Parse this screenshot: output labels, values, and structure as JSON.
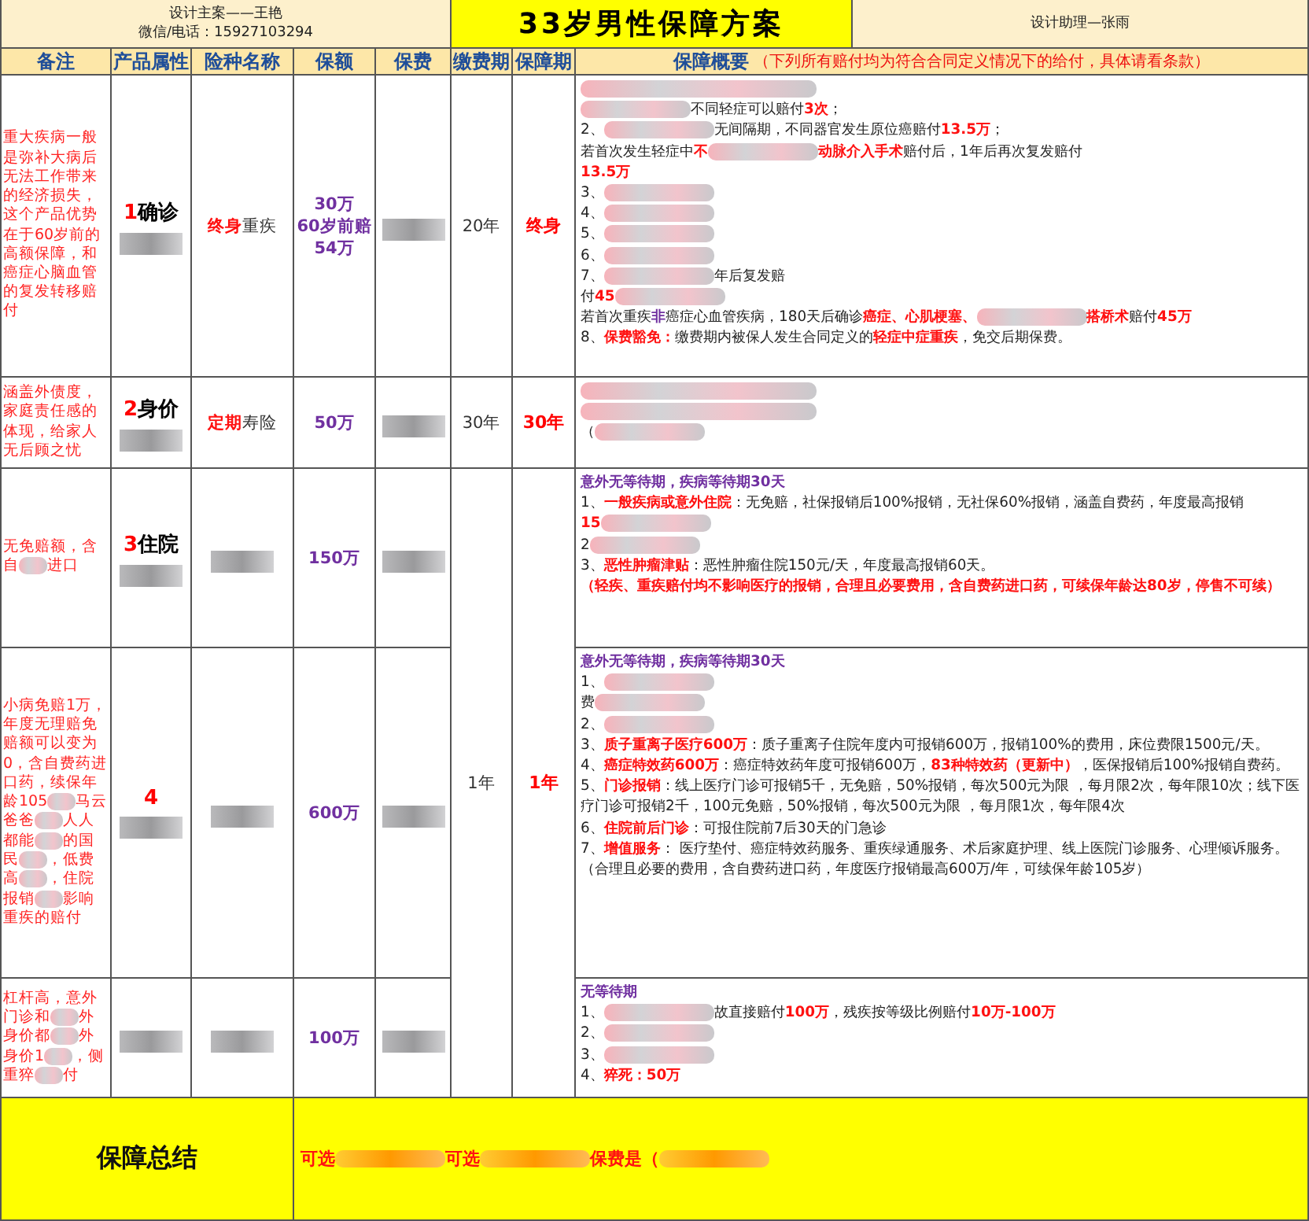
{
  "header": {
    "designer": [
      "设计主案——王艳",
      "微信/电话：15927103294"
    ],
    "title": "33岁男性保障方案",
    "assistant": "设计助理—张雨"
  },
  "columns": [
    {
      "label": "备注"
    },
    {
      "label": "产品属性"
    },
    {
      "label": "险种名称"
    },
    {
      "label": "保额"
    },
    {
      "label": "保费"
    },
    {
      "label": "缴费期"
    },
    {
      "label": "保障期"
    },
    {
      "label": "保障概要",
      "note": "（下列所有赔付均为符合合同定义情况下的给付，具体请看条款）"
    }
  ],
  "rows": [
    {
      "remark": [
        {
          "kind": "plain",
          "t": "重大疾病一般是弥补大病后无法工作带来的经济损失，这个产品优势在于60岁前的高额保障，和癌症心脑血管的复发转移赔付"
        }
      ],
      "product": {
        "number": "1",
        "name": "确诊"
      },
      "insurance": [
        {
          "kind": "red",
          "t": "终身"
        },
        {
          "kind": "plain",
          "t": "重疾"
        }
      ],
      "amount": [
        "30万",
        "60岁前赔",
        "54万"
      ],
      "pay_period": "20年",
      "term": "终身",
      "summary": [
        [
          {
            "kind": "redacted"
          }
        ],
        [
          {
            "kind": "redacted"
          },
          {
            "kind": "plain",
            "t": "不同轻症可以赔付"
          },
          {
            "kind": "red",
            "t": "3次"
          },
          {
            "kind": "plain",
            "t": "；"
          }
        ],
        [
          {
            "kind": "plain",
            "t": "2、"
          },
          {
            "kind": "redacted"
          },
          {
            "kind": "plain",
            "t": "无间隔期，不同器官发生原位癌赔付"
          },
          {
            "kind": "red",
            "t": "13.5万"
          },
          {
            "kind": "plain",
            "t": "；"
          }
        ],
        [
          {
            "kind": "plain",
            "t": "若首次发生轻症中"
          },
          {
            "kind": "red",
            "t": "不"
          },
          {
            "kind": "redacted"
          },
          {
            "kind": "red",
            "t": "动脉介入手术"
          },
          {
            "kind": "plain",
            "t": "赔付后，1年后再次复发赔付"
          }
        ],
        [
          {
            "kind": "red",
            "t": "13.5万"
          }
        ],
        [
          {
            "kind": "plain",
            "t": "3、"
          },
          {
            "kind": "redacted"
          }
        ],
        [
          {
            "kind": "plain",
            "t": "4、"
          },
          {
            "kind": "redacted"
          }
        ],
        [
          {
            "kind": "plain",
            "t": "5、"
          },
          {
            "kind": "redacted"
          }
        ],
        [
          {
            "kind": "plain",
            "t": "6、"
          },
          {
            "kind": "redacted"
          }
        ],
        [
          {
            "kind": "plain",
            "t": "7、"
          },
          {
            "kind": "redacted"
          },
          {
            "kind": "plain",
            "t": "年后复发赔"
          }
        ],
        [
          {
            "kind": "plain",
            "t": "付"
          },
          {
            "kind": "red",
            "t": "45"
          },
          {
            "kind": "redacted"
          }
        ],
        [
          {
            "kind": "plain",
            "t": "若首次重疾"
          },
          {
            "kind": "purple",
            "t": "非"
          },
          {
            "kind": "plain",
            "t": "癌症心血管疾病，180天后确诊"
          },
          {
            "kind": "red",
            "t": "癌症、心肌梗塞、"
          },
          {
            "kind": "redacted"
          },
          {
            "kind": "red",
            "t": "搭桥术"
          },
          {
            "kind": "plain",
            "t": "赔付"
          },
          {
            "kind": "red",
            "t": "45万"
          }
        ],
        [
          {
            "kind": "plain",
            "t": "8、"
          },
          {
            "kind": "red",
            "t": "保费豁免："
          },
          {
            "kind": "plain",
            "t": "缴费期内被保人发生合同定义的"
          },
          {
            "kind": "red",
            "t": "轻症中症重疾"
          },
          {
            "kind": "plain",
            "t": "，免交后期保费。"
          }
        ]
      ]
    },
    {
      "remark": [
        {
          "kind": "plain",
          "t": "涵盖外债度，家庭责任感的体现，给家人无后顾之忧"
        }
      ],
      "product": {
        "number": "2",
        "name": "身价"
      },
      "insurance": [
        {
          "kind": "red",
          "t": "定期"
        },
        {
          "kind": "plain",
          "t": "寿险"
        }
      ],
      "amount": [
        "50万"
      ],
      "pay_period": "30年",
      "term": "30年",
      "summary": [
        [
          {
            "kind": "redacted"
          }
        ],
        [
          {
            "kind": "redacted"
          }
        ],
        [
          {
            "kind": "plain",
            "t": "（"
          },
          {
            "kind": "redacted"
          }
        ]
      ]
    }
  ],
  "grouped_rows": {
    "pay_period": "1年",
    "term": "1年",
    "rows": [
      {
        "remark": [
          {
            "kind": "plain",
            "t": "无免赔额，含自"
          },
          {
            "kind": "redacted"
          },
          {
            "kind": "plain",
            "t": "进口"
          }
        ],
        "product": {
          "number": "3",
          "name": "住院"
        },
        "amount": [
          "150万"
        ],
        "summary": [
          [
            {
              "kind": "purple",
              "t": "意外无等待期，疾病等待期30天"
            }
          ],
          [
            {
              "kind": "plain",
              "t": "1、"
            },
            {
              "kind": "red",
              "t": "一般疾病或意外住院"
            },
            {
              "kind": "plain",
              "t": "：无免赔，社保报销后100%报销，无社保60%报销，涵盖自费药，年度最高报销"
            }
          ],
          [
            {
              "kind": "red",
              "t": "15"
            },
            {
              "kind": "redacted"
            }
          ],
          [
            {
              "kind": "plain",
              "t": "2"
            },
            {
              "kind": "redacted"
            }
          ],
          [
            {
              "kind": "plain",
              "t": "3、"
            },
            {
              "kind": "red",
              "t": "恶性肿瘤津贴"
            },
            {
              "kind": "plain",
              "t": "：恶性肿瘤住院150元/天，年度最高报销60天。"
            }
          ],
          [
            {
              "kind": "red",
              "t": "（轻疾、重疾赔付均不影响医疗的报销，合理且必要费用，含自费药进口药，可续保年龄达80岁，停售不可续）"
            }
          ]
        ]
      },
      {
        "remark": [
          {
            "kind": "plain",
            "t": "小病免赔1万，年度无理赔免赔额可以变为0，含自费药进口药，续保年龄105"
          },
          {
            "kind": "redacted"
          },
          {
            "kind": "plain",
            "t": "马云爸爸"
          },
          {
            "kind": "redacted"
          },
          {
            "kind": "plain",
            "t": "人人都能"
          },
          {
            "kind": "redacted"
          },
          {
            "kind": "plain",
            "t": "的国民"
          },
          {
            "kind": "redacted"
          },
          {
            "kind": "plain",
            "t": "，低费高"
          },
          {
            "kind": "redacted"
          },
          {
            "kind": "plain",
            "t": "，住院报销"
          },
          {
            "kind": "redacted"
          },
          {
            "kind": "plain",
            "t": "影响重疾的赔付"
          }
        ],
        "product": {
          "number": "4"
        },
        "amount": [
          "600万"
        ],
        "summary": [
          [
            {
              "kind": "purple",
              "t": "意外无等待期，疾病等待期30天"
            }
          ],
          [
            {
              "kind": "plain",
              "t": "1、"
            },
            {
              "kind": "redacted"
            }
          ],
          [
            {
              "kind": "plain",
              "t": "费"
            },
            {
              "kind": "redacted"
            }
          ],
          [
            {
              "kind": "plain",
              "t": "2、"
            },
            {
              "kind": "redacted"
            }
          ],
          [
            {
              "kind": "plain",
              "t": "3、"
            },
            {
              "kind": "red",
              "t": "质子重离子医疗600万"
            },
            {
              "kind": "plain",
              "t": "：质子重离子住院年度内可报销600万，报销100%的费用，床位费限1500元/天。"
            }
          ],
          [
            {
              "kind": "plain",
              "t": "4、"
            },
            {
              "kind": "red",
              "t": "癌症特效药600万"
            },
            {
              "kind": "plain",
              "t": "：癌症特效药年度可报销600万，"
            },
            {
              "kind": "red",
              "t": "83种特效药（更新中）"
            },
            {
              "kind": "plain",
              "t": "，医保报销后100%报销自费药。"
            }
          ],
          [
            {
              "kind": "plain",
              "t": "5、"
            },
            {
              "kind": "red",
              "t": "门诊报销"
            },
            {
              "kind": "plain",
              "t": "：线上医疗门诊可报销5千，无免赔，50%报销，每次500元为限 ，每月限2次，每年限10次；线下医疗门诊可报销2千，100元免赔，50%报销，每次500元为限 ，每月限1次，每年限4次"
            }
          ],
          [
            {
              "kind": "plain",
              "t": "6、"
            },
            {
              "kind": "red",
              "t": "住院前后门诊"
            },
            {
              "kind": "plain",
              "t": "：可报住院前7后30天的门急诊"
            }
          ],
          [
            {
              "kind": "plain",
              "t": "7、"
            },
            {
              "kind": "red",
              "t": "增值服务"
            },
            {
              "kind": "plain",
              "t": "： 医疗垫付、癌症特效药服务、重疾绿通服务、术后家庭护理、线上医院门诊服务、心理倾诉服务。"
            }
          ],
          [
            {
              "kind": "plain",
              "t": "（合理且必要的费用，含自费药进口药，年度医疗报销最高600万/年，可续保年龄105岁）"
            }
          ]
        ]
      },
      {
        "remark": [
          {
            "kind": "plain",
            "t": "杠杆高，意外门诊和"
          },
          {
            "kind": "redacted"
          },
          {
            "kind": "plain",
            "t": "外身价都"
          },
          {
            "kind": "redacted"
          },
          {
            "kind": "plain",
            "t": "外身价1"
          },
          {
            "kind": "redacted"
          },
          {
            "kind": "plain",
            "t": "，侧重猝"
          },
          {
            "kind": "redacted"
          },
          {
            "kind": "plain",
            "t": "付"
          }
        ],
        "amount": [
          "100万"
        ],
        "summary": [
          [
            {
              "kind": "purple",
              "t": "无等待期"
            }
          ],
          [
            {
              "kind": "plain",
              "t": "1、"
            },
            {
              "kind": "redacted"
            },
            {
              "kind": "plain",
              "t": "故直接赔付"
            },
            {
              "kind": "red",
              "t": "100万"
            },
            {
              "kind": "plain",
              "t": "，残疾按等级比例赔付"
            },
            {
              "kind": "red",
              "t": "10万-100万"
            }
          ],
          [
            {
              "kind": "plain",
              "t": "2、"
            },
            {
              "kind": "redacted"
            }
          ],
          [
            {
              "kind": "plain",
              "t": "3、"
            },
            {
              "kind": "redacted"
            }
          ],
          [
            {
              "kind": "plain",
              "t": "4、"
            },
            {
              "kind": "red",
              "t": "猝死：50万"
            }
          ]
        ]
      }
    ]
  },
  "footer": {
    "label": "保障总结",
    "text": [
      {
        "kind": "red",
        "t": "可选"
      },
      {
        "kind": "redacted"
      },
      {
        "kind": "red",
        "t": "可选"
      },
      {
        "kind": "redacted"
      },
      {
        "kind": "red",
        "t": "保费是（"
      },
      {
        "kind": "redacted"
      }
    ]
  }
}
